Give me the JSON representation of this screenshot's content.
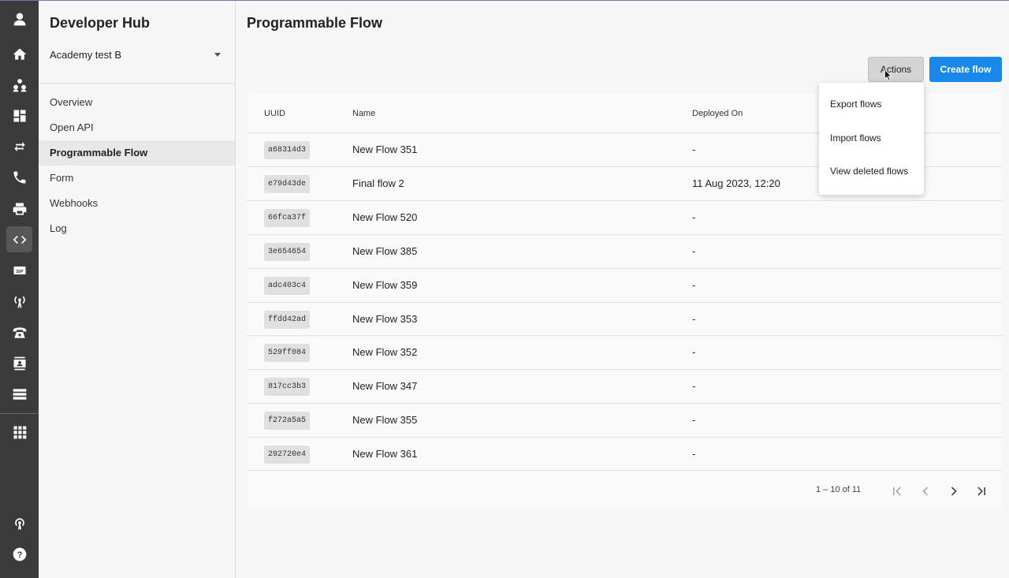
{
  "sidebar": {
    "title": "Developer Hub",
    "account": "Academy test B",
    "nav": [
      {
        "label": "Overview"
      },
      {
        "label": "Open API"
      },
      {
        "label": "Programmable Flow"
      },
      {
        "label": "Form"
      },
      {
        "label": "Webhooks"
      },
      {
        "label": "Log"
      }
    ]
  },
  "rail": {
    "icons": [
      "user-avatar-icon",
      "home-icon",
      "contacts-group-icon",
      "dashboard-icon",
      "transfer-arrows-icon",
      "phone-call-icon",
      "printer-icon",
      "code-icon",
      "sip-icon",
      "broadcast-icon",
      "telephone-icon",
      "contact-card-icon",
      "server-list-icon",
      "apps-grid-icon",
      "signal-icon",
      "help-icon"
    ]
  },
  "main": {
    "title": "Programmable Flow",
    "actions_label": "Actions",
    "create_label": "Create flow"
  },
  "table": {
    "headers": {
      "uuid": "UUID",
      "name": "Name",
      "deployed": "Deployed On"
    },
    "rows": [
      {
        "uuid": "a68314d3",
        "name": "New Flow 351",
        "deployed": "-"
      },
      {
        "uuid": "e79d43de",
        "name": "Final flow 2",
        "deployed": "11 Aug 2023, 12:20"
      },
      {
        "uuid": "66fca37f",
        "name": "New Flow 520",
        "deployed": "-"
      },
      {
        "uuid": "3e654654",
        "name": "New Flow 385",
        "deployed": "-"
      },
      {
        "uuid": "adc403c4",
        "name": "New Flow 359",
        "deployed": "-"
      },
      {
        "uuid": "ffdd42ad",
        "name": "New Flow 353",
        "deployed": "-"
      },
      {
        "uuid": "529ff084",
        "name": "New Flow 352",
        "deployed": "-"
      },
      {
        "uuid": "817cc3b3",
        "name": "New Flow 347",
        "deployed": "-"
      },
      {
        "uuid": "f272a5a5",
        "name": "New Flow 355",
        "deployed": "-"
      },
      {
        "uuid": "292720e4",
        "name": "New Flow 361",
        "deployed": "-"
      }
    ]
  },
  "pagination": {
    "range": "1 – 10 of 11"
  },
  "actions_menu": {
    "items": [
      {
        "label": "Export flows"
      },
      {
        "label": "Import flows"
      },
      {
        "label": "View deleted flows"
      }
    ]
  }
}
